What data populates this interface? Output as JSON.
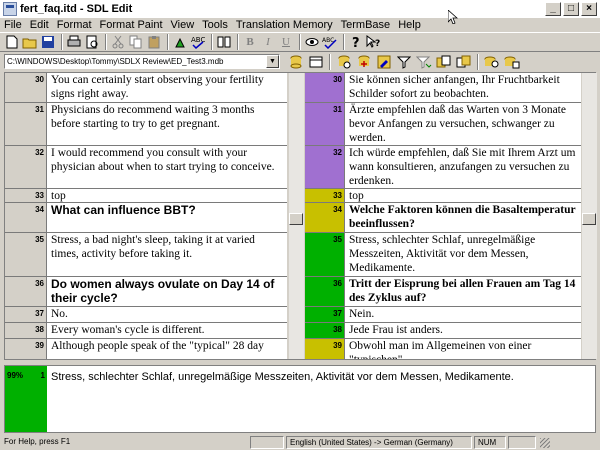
{
  "window": {
    "title": "fert_faq.itd - SDL Edit",
    "controls": [
      "_",
      "□",
      "×"
    ]
  },
  "menu": [
    "File",
    "Edit",
    "Format",
    "Format Paint",
    "View",
    "Tools",
    "Translation Memory",
    "TermBase",
    "Help"
  ],
  "path": "C:\\WINDOWS\\Desktop\\Tommy\\SDLX Review\\ED_Test3.mdb",
  "toolbar_icons": [
    "new-icon",
    "open-icon",
    "save-icon",
    "print-icon",
    "print-preview-icon",
    "cut-icon",
    "copy-icon",
    "paste-icon",
    "paint-icon",
    "spellcheck-icon",
    "columns-icon",
    "bold-icon",
    "italic-icon",
    "underline-icon",
    "eye-icon",
    "check-icon",
    "help-icon",
    "context-help-icon"
  ],
  "toolbar_text": {
    "bold": "B",
    "italic": "I",
    "underline": "U"
  },
  "segments": [
    {
      "num": "30",
      "src": "You can certainly start observing your fertility signs right away.",
      "tgt": "Sie können sicher anfangen, Ihr Fruchtbarkeit Schilder sofort zu beobachten.",
      "color": "#a070d0",
      "style": ""
    },
    {
      "num": "31",
      "src": "Physicians do recommend waiting 3 months before starting to try to get pregnant.",
      "tgt": "Ärzte empfehlen daß das Warten von 3 Monate bevor Anfangen zu versuchen, schwanger zu werden.",
      "color": "#a070d0",
      "style": ""
    },
    {
      "num": "32",
      "src": "I would recommend you consult with your physician about when to start trying to conceive.",
      "tgt": "Ich würde empfehlen, daß Sie mit Ihrem Arzt um wann konsultieren, anzufangen zu versuchen zu erdenken.",
      "color": "#a070d0",
      "style": ""
    },
    {
      "num": "33",
      "src": "top",
      "tgt": "top",
      "color": "#c8c000",
      "style": ""
    },
    {
      "num": "34",
      "src": "What can influence BBT?",
      "tgt": "Welche Faktoren können die Basaltemperatur beeinflussen?",
      "color": "#c8c000",
      "style": "head"
    },
    {
      "num": "35",
      "src": "Stress, a bad night's sleep, taking it at varied times, activity before taking it.",
      "tgt": "Stress, schlechter Schlaf, unregelmäßige Messzeiten, Aktivität vor dem Messen, Medikamente.",
      "color": "#00b000",
      "style": ""
    },
    {
      "num": "36",
      "src": "Do women always ovulate on Day 14 of their cycle?",
      "tgt": "Tritt der Eisprung bei allen Frauen am Tag 14 des Zyklus auf?",
      "color": "#00b000",
      "style": "head"
    },
    {
      "num": "37",
      "src": "No.",
      "tgt": "Nein.",
      "color": "#00b000",
      "style": ""
    },
    {
      "num": "38",
      "src": "Every woman's cycle is different.",
      "tgt": "Jede Frau ist anders.",
      "color": "#00b000",
      "style": ""
    },
    {
      "num": "39",
      "src": "Although people speak of the \"typical\" 28 day",
      "tgt": "Obwohl man im Allgemeinen von einer \"typischen\"",
      "color": "#c8c000",
      "style": ""
    }
  ],
  "editor": {
    "match_percent": "99%",
    "segment_num": "1",
    "text": "Stress, schlechter Schlaf, unregelmäßige Messzeiten, Aktivität vor dem Messen, Medikamente."
  },
  "status": {
    "help": "For Help, press F1",
    "languages": "English (United States) -> German (Germany)",
    "num": "NUM"
  },
  "colors": {
    "fuzzy": "#a070d0",
    "unconfirmed": "#c8c000",
    "confirmed": "#00b000"
  }
}
